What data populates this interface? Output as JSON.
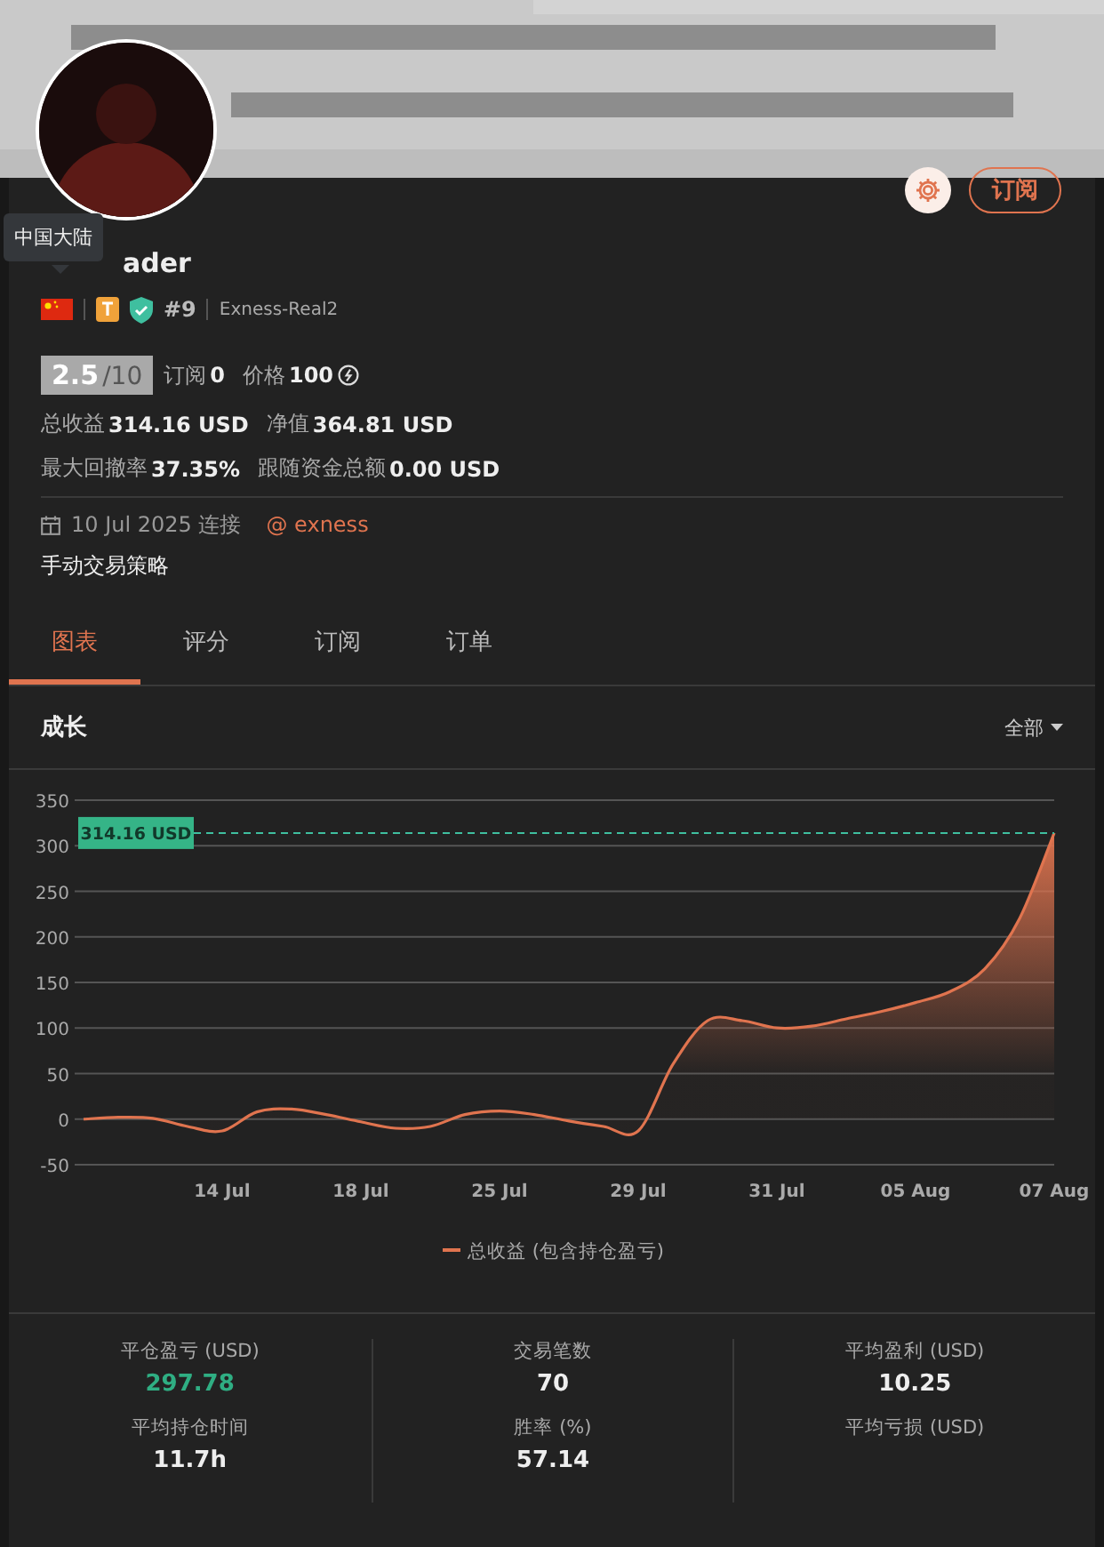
{
  "banner": {
    "kind": "picture"
  },
  "header": {
    "subscribe_button": "订阅",
    "tooltip": "中国大陆",
    "name": "ader",
    "rank": "#9",
    "server": "Exness-Real2"
  },
  "score": {
    "value": "2.5",
    "max": "/10"
  },
  "summary": [
    {
      "label": "订阅",
      "value": "0",
      "coin": false
    },
    {
      "label": "价格",
      "value": "100",
      "coin": true
    }
  ],
  "metrics": [
    [
      {
        "label": "总收益",
        "value": "314.16 USD"
      },
      {
        "label": "净值",
        "value": "364.81 USD"
      }
    ],
    [
      {
        "label": "最大回撤率",
        "value": "37.35%"
      },
      {
        "label": "跟随资金总额",
        "value": "0.00 USD"
      }
    ]
  ],
  "connected": {
    "date": "10 Jul 2025 连接",
    "broker": "@ exness"
  },
  "strategy": "手动交易策略",
  "tabs": [
    {
      "label": "图表",
      "selected": true
    },
    {
      "label": "评分",
      "selected": false
    },
    {
      "label": "订阅",
      "selected": false
    },
    {
      "label": "订单",
      "selected": false
    }
  ],
  "section": {
    "title": "成长",
    "filter": "全部"
  },
  "chart_data": {
    "type": "area",
    "categories": [
      null,
      null,
      null,
      null,
      "14 Jul",
      null,
      null,
      null,
      "18 Jul",
      null,
      null,
      null,
      "25 Jul",
      null,
      null,
      null,
      "29 Jul",
      null,
      null,
      null,
      "31 Jul",
      null,
      null,
      null,
      "05 Aug",
      null,
      null,
      null,
      "07 Aug"
    ],
    "series": [
      {
        "name": "总收益 (包含持仓盈亏)",
        "color": "#e0744f",
        "values": [
          0,
          2,
          1,
          -8,
          -13,
          8,
          11,
          5,
          -3,
          -10,
          -8,
          5,
          9,
          5,
          -2,
          -8,
          -13,
          60,
          108,
          108,
          100,
          102,
          110,
          118,
          128,
          140,
          165,
          220,
          314
        ]
      }
    ],
    "ylim": [
      -50,
      350
    ],
    "yticks": [
      -50,
      0,
      50,
      100,
      150,
      200,
      250,
      300,
      350
    ],
    "grid": true,
    "ref_lines": [
      {
        "axis": "y",
        "value": 314,
        "color": "#3fbf9f"
      }
    ],
    "annotations": [
      "314.16 USD"
    ]
  },
  "stats": [
    [
      {
        "label": "平仓盈亏 (USD)",
        "value": "297.78",
        "positive": true
      },
      {
        "label": "平均持仓时间",
        "value": "11.7h",
        "positive": false
      }
    ],
    [
      {
        "label": "交易笔数",
        "value": "70",
        "positive": false
      },
      {
        "label": "胜率 (%)",
        "value": "57.14",
        "positive": false
      }
    ],
    [
      {
        "label": "平均盈利 (USD)",
        "value": "10.25",
        "positive": false
      },
      {
        "label": "平均亏损 (USD)"
      }
    ]
  ]
}
